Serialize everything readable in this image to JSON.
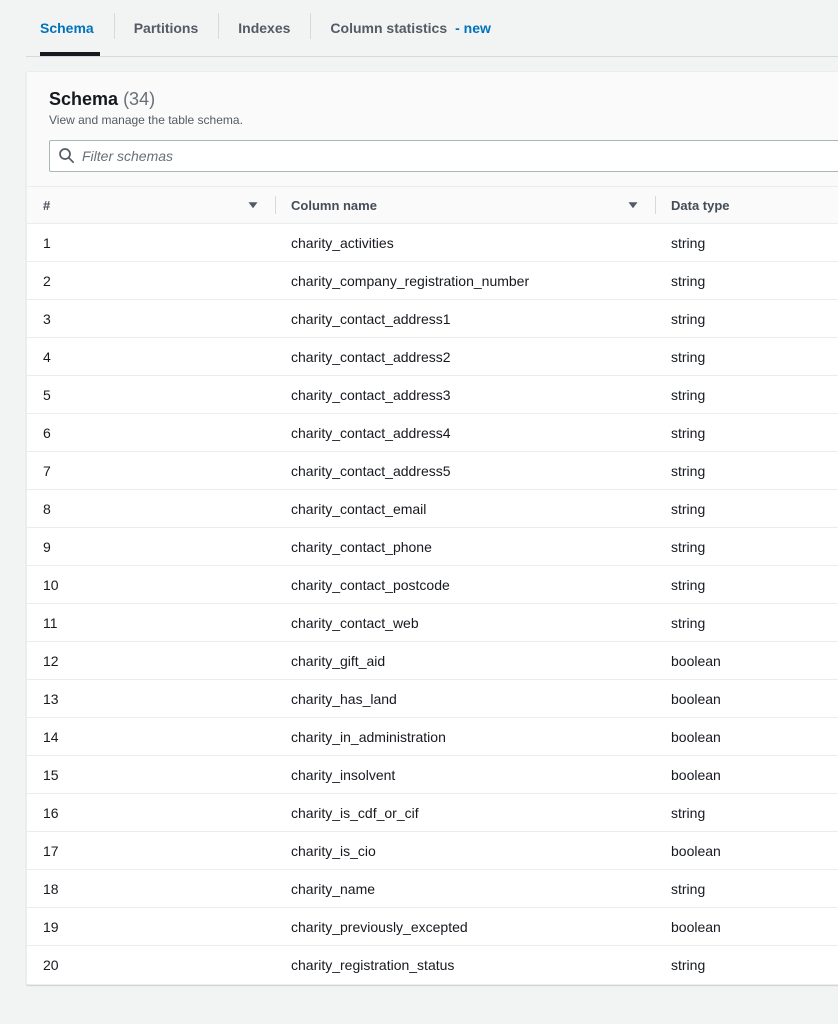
{
  "tabs": [
    {
      "label": "Schema",
      "active": true,
      "badge": null
    },
    {
      "label": "Partitions",
      "active": false,
      "badge": null
    },
    {
      "label": "Indexes",
      "active": false,
      "badge": null
    },
    {
      "label": "Column statistics",
      "active": false,
      "badge": "- new"
    }
  ],
  "panel": {
    "title": "Schema",
    "count": "(34)",
    "description": "View and manage the table schema."
  },
  "filter": {
    "value": "",
    "placeholder": "Filter schemas",
    "icon": "search-icon"
  },
  "table": {
    "headers": [
      {
        "label": "#",
        "sort_icon": "sort-descending-icon"
      },
      {
        "label": "Column name",
        "sort_icon": "sort-descending-icon"
      },
      {
        "label": "Data type",
        "sort_icon": "sort-descending-icon"
      }
    ],
    "rows": [
      {
        "num": "1",
        "name": "charity_activities",
        "type": "string"
      },
      {
        "num": "2",
        "name": "charity_company_registration_number",
        "type": "string"
      },
      {
        "num": "3",
        "name": "charity_contact_address1",
        "type": "string"
      },
      {
        "num": "4",
        "name": "charity_contact_address2",
        "type": "string"
      },
      {
        "num": "5",
        "name": "charity_contact_address3",
        "type": "string"
      },
      {
        "num": "6",
        "name": "charity_contact_address4",
        "type": "string"
      },
      {
        "num": "7",
        "name": "charity_contact_address5",
        "type": "string"
      },
      {
        "num": "8",
        "name": "charity_contact_email",
        "type": "string"
      },
      {
        "num": "9",
        "name": "charity_contact_phone",
        "type": "string"
      },
      {
        "num": "10",
        "name": "charity_contact_postcode",
        "type": "string"
      },
      {
        "num": "11",
        "name": "charity_contact_web",
        "type": "string"
      },
      {
        "num": "12",
        "name": "charity_gift_aid",
        "type": "boolean"
      },
      {
        "num": "13",
        "name": "charity_has_land",
        "type": "boolean"
      },
      {
        "num": "14",
        "name": "charity_in_administration",
        "type": "boolean"
      },
      {
        "num": "15",
        "name": "charity_insolvent",
        "type": "boolean"
      },
      {
        "num": "16",
        "name": "charity_is_cdf_or_cif",
        "type": "string"
      },
      {
        "num": "17",
        "name": "charity_is_cio",
        "type": "boolean"
      },
      {
        "num": "18",
        "name": "charity_name",
        "type": "string"
      },
      {
        "num": "19",
        "name": "charity_previously_excepted",
        "type": "boolean"
      },
      {
        "num": "20",
        "name": "charity_registration_status",
        "type": "string"
      }
    ]
  },
  "colors": {
    "accent_link": "#0073bb",
    "active_tab_underline": "#16191f",
    "page_background": "#f2f3f3",
    "header_background": "#fafafa",
    "border": "#eaeded"
  }
}
